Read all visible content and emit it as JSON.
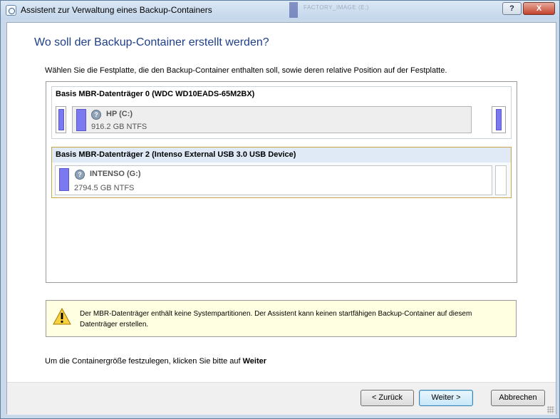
{
  "window": {
    "title": "Assistent zur Verwaltung eines Backup-Containers",
    "background_window_text": "FACTORY_IMAGE (E:)"
  },
  "page": {
    "title": "Wo soll der Backup-Container erstellt werden?",
    "instruction": "Wählen Sie die Festplatte, die den Backup-Container enthalten soll, sowie deren relative Position auf der Festplatte."
  },
  "disks": [
    {
      "label": "Basis MBR-Datenträger 0 (WDC WD10EADS-65M2BX)",
      "partition_name": "HP (C:)",
      "partition_size": "916.2 GB NTFS",
      "selected": false
    },
    {
      "label": "Basis MBR-Datenträger 2 (Intenso External USB 3.0 USB Device)",
      "partition_name": "INTENSO (G:)",
      "partition_size": "2794.5 GB NTFS",
      "selected": true
    }
  ],
  "warning": {
    "text": "Der MBR-Datenträger enthält keine Systempartitionen. Der Assistent kann keinen startfähigen Backup-Container auf diesem Datenträger erstellen.",
    "icon": "warning-icon"
  },
  "footer": {
    "hint_prefix": "Um die Containergröße festzulegen, klicken Sie bitte auf",
    "hint_keyword": "Weiter"
  },
  "buttons": {
    "back": "< Zurück",
    "next": "Weiter >",
    "cancel": "Abbrechen"
  },
  "caption_buttons": {
    "help": "?",
    "close": "X"
  },
  "colors": {
    "title_blue": "#1e3f87",
    "partition_fill": "#7b79ef",
    "warning_bg": "#ffffe1",
    "selected_border": "#c9a64a"
  }
}
